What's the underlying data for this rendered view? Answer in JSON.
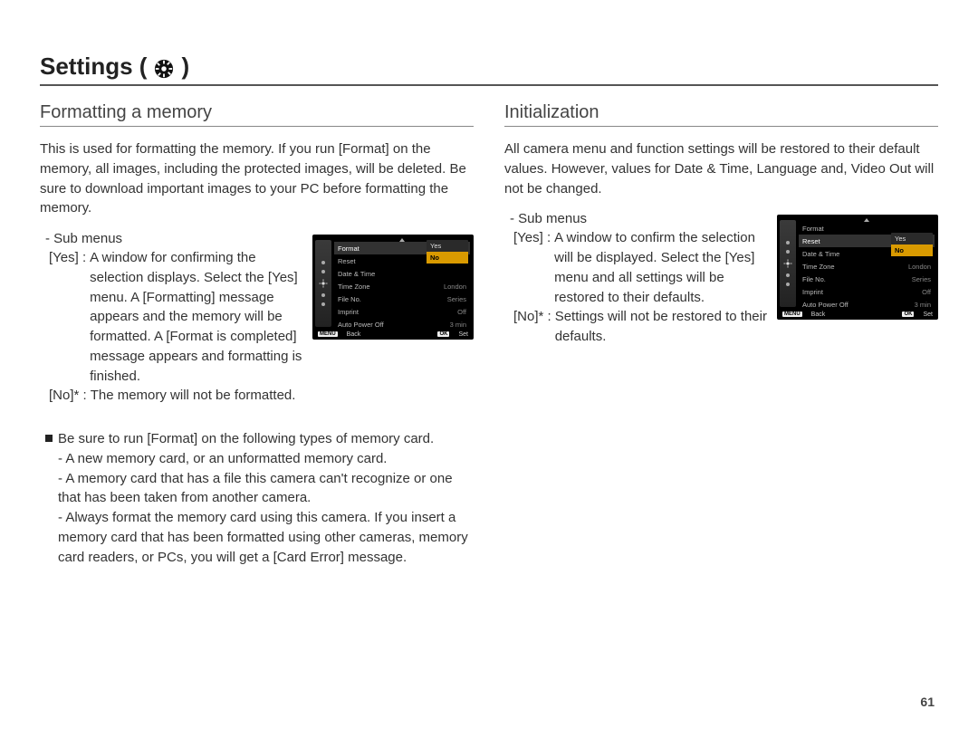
{
  "chapter": {
    "title": "Settings (",
    "title_close": ")"
  },
  "left": {
    "heading": "Formatting a memory",
    "intro": "This is used for formatting the memory. If you run [Format] on the memory, all images, including the protected images, will be deleted. Be sure to download important images to your PC before formatting the memory.",
    "sub_label": "- Sub menus",
    "yes_key": "[Yes] :",
    "yes_desc": "A window for confirming the selection displays. Select the [Yes] menu. A [Formatting] message appears and the memory will be formatted. A [Format is completed] message appears and formatting is finished.",
    "no_key": "[No]* :",
    "no_desc": "The memory will not be formatted.",
    "note_lead": "Be sure to run [Format] on the following types of memory card.",
    "note_b1": "- A new memory card, or an unformatted memory card.",
    "note_b2": "- A memory card that has a file this camera can't recognize or one that has been taken from another camera.",
    "note_b3": "- Always format the memory card using this camera. If you insert a memory card that has been formatted using other cameras, memory card readers, or PCs, you will get a [Card Error] message."
  },
  "right": {
    "heading": "Initialization",
    "intro": "All camera menu and function settings will be restored to their default values. However, values for Date & Time, Language and, Video Out will not be changed.",
    "sub_label": "- Sub menus",
    "yes_key": "[Yes] :",
    "yes_desc": "A window to confirm the selection will be displayed. Select the [Yes] menu and all settings will be restored to their defaults.",
    "no_key": "[No]* :",
    "no_desc": "Settings will not be restored to their defaults."
  },
  "cam_menu_left": {
    "highlighted": "Format",
    "items": [
      {
        "label": "Format",
        "value": ""
      },
      {
        "label": "Reset",
        "value": ""
      },
      {
        "label": "Date & Time",
        "value": ""
      },
      {
        "label": "Time Zone",
        "value": "London"
      },
      {
        "label": "File No.",
        "value": "Series"
      },
      {
        "label": "Imprint",
        "value": "Off"
      },
      {
        "label": "Auto Power Off",
        "value": "3 min"
      }
    ],
    "popup": {
      "opt1": "Yes",
      "opt2": "No"
    },
    "footer": {
      "back_btn": "MENU",
      "back": "Back",
      "set_btn": "OK",
      "set": "Set"
    }
  },
  "cam_menu_right": {
    "highlighted": "Reset",
    "items": [
      {
        "label": "Format",
        "value": ""
      },
      {
        "label": "Reset",
        "value": ""
      },
      {
        "label": "Date & Time",
        "value": ""
      },
      {
        "label": "Time Zone",
        "value": "London"
      },
      {
        "label": "File No.",
        "value": "Series"
      },
      {
        "label": "Imprint",
        "value": "Off"
      },
      {
        "label": "Auto Power Off",
        "value": "3 min"
      }
    ],
    "popup": {
      "opt1": "Yes",
      "opt2": "No"
    },
    "footer": {
      "back_btn": "MENU",
      "back": "Back",
      "set_btn": "OK",
      "set": "Set"
    }
  },
  "page_number": "61"
}
